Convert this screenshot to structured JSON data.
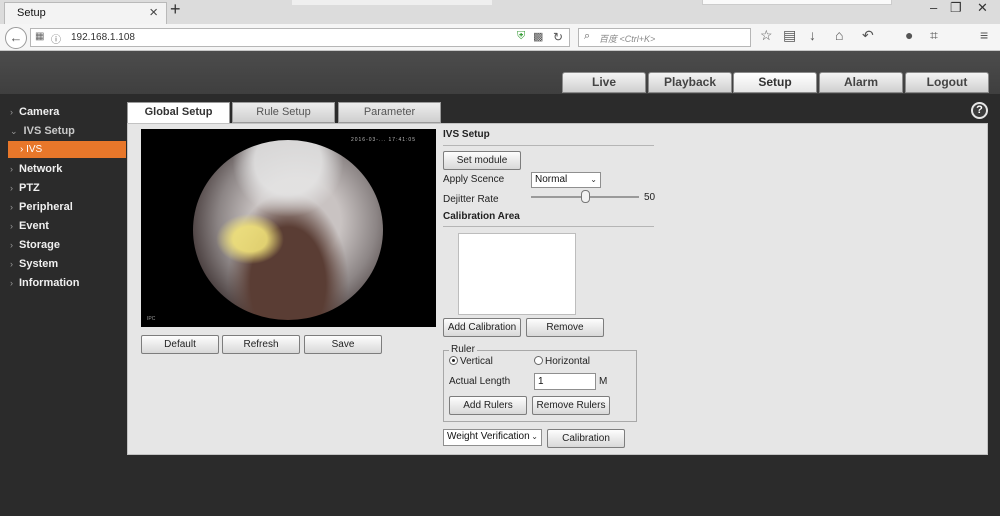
{
  "browser": {
    "tab_title": "Setup",
    "tab_close": "×",
    "new_tab": "+",
    "url": "192.168.1.108",
    "search_placeholder": "百度 <Ctrl+K>",
    "window_controls": [
      "–",
      "❐",
      "✕"
    ]
  },
  "top_nav": {
    "tabs": [
      "Live",
      "Playback",
      "Setup",
      "Alarm",
      "Logout"
    ],
    "active": "Setup"
  },
  "sidebar": {
    "items": [
      {
        "label": "Camera",
        "expanded": false
      },
      {
        "label": "IVS Setup",
        "expanded": true
      },
      {
        "label": "Network",
        "expanded": false
      },
      {
        "label": "PTZ",
        "expanded": false
      },
      {
        "label": "Peripheral",
        "expanded": false
      },
      {
        "label": "Event",
        "expanded": false
      },
      {
        "label": "Storage",
        "expanded": false
      },
      {
        "label": "System",
        "expanded": false
      },
      {
        "label": "Information",
        "expanded": false
      }
    ],
    "sub_item": "IVS"
  },
  "sub_tabs": [
    "Global Setup",
    "Rule Setup",
    "Parameter"
  ],
  "active_sub_tab": "Global Setup",
  "help_icon": "?",
  "video": {
    "timestamp": "2016-03-... 17:41:05",
    "corner_label": "IPC"
  },
  "video_buttons": {
    "default": "Default",
    "refresh": "Refresh",
    "save": "Save"
  },
  "ivs_setup": {
    "title": "IVS Setup",
    "set_module": "Set module",
    "apply_scene_label": "Apply Scence",
    "apply_scene_value": "Normal",
    "dejitter_label": "Dejitter Rate",
    "dejitter_value": "50",
    "dejitter_level": 50,
    "calibration_area_title": "Calibration Area",
    "add_calibration": "Add Calibration",
    "remove": "Remove"
  },
  "ruler": {
    "legend": "Ruler",
    "vertical": "Vertical",
    "horizontal": "Horizontal",
    "selected": "Vertical",
    "actual_length_label": "Actual Length",
    "actual_length_value": "1",
    "unit": "M",
    "add_rulers": "Add Rulers",
    "remove_rulers": "Remove Rulers"
  },
  "verification": {
    "select_value": "Weight Verification",
    "calibration_button": "Calibration"
  }
}
